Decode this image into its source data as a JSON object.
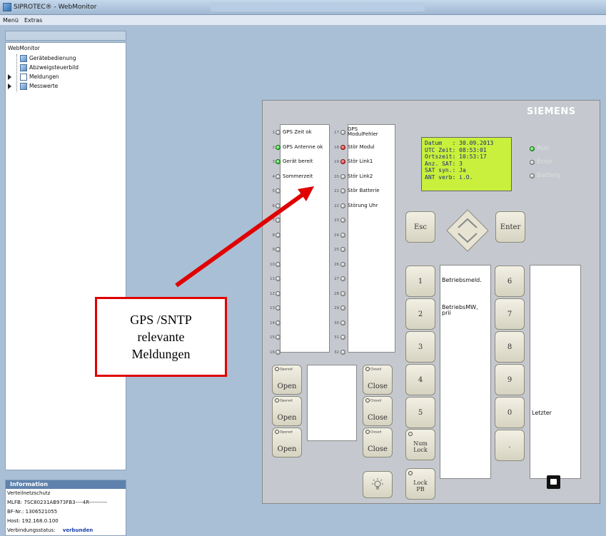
{
  "window": {
    "title": "SIPROTEC® - WebMonitor"
  },
  "menu": [
    "Menü",
    "Extras"
  ],
  "tree": {
    "root": "WebMonitor",
    "items": [
      {
        "label": "Gerätebedienung",
        "icon": "device-operation-icon"
      },
      {
        "label": "Abzweigsteuerbild",
        "icon": "feeder-control-icon"
      },
      {
        "label": "Meldungen",
        "icon": "messages-icon"
      },
      {
        "label": "Messwerte",
        "icon": "measurements-icon"
      }
    ]
  },
  "info": {
    "header": "Information",
    "lines": [
      "Verteilnetzschutz",
      "MLFB:  7SC80231AB973FB3----4R----------",
      "BF-Nr.: 1306521055",
      "Host: 192.168.0.100"
    ],
    "status_label": "Verbindungsstatus:",
    "status_value": "verbunden"
  },
  "device": {
    "brand": "SIEMENS",
    "leds_left": [
      {
        "n": "1",
        "label": "GPS Zeit ok",
        "color": "gray"
      },
      {
        "n": "2",
        "label": "GPS Antenne ok",
        "color": "green"
      },
      {
        "n": "3",
        "label": "Gerät bereit",
        "color": "green"
      },
      {
        "n": "4",
        "label": "Sommerzeit",
        "color": "gray"
      },
      {
        "n": "5",
        "label": "",
        "color": "gray"
      },
      {
        "n": "6",
        "label": "",
        "color": "gray"
      },
      {
        "n": "7",
        "label": "",
        "color": "gray"
      },
      {
        "n": "8",
        "label": "",
        "color": "gray"
      },
      {
        "n": "9",
        "label": "",
        "color": "gray"
      },
      {
        "n": "10",
        "label": "",
        "color": "gray"
      },
      {
        "n": "11",
        "label": "",
        "color": "gray"
      },
      {
        "n": "12",
        "label": "",
        "color": "gray"
      },
      {
        "n": "13",
        "label": "",
        "color": "gray"
      },
      {
        "n": "14",
        "label": "",
        "color": "gray"
      },
      {
        "n": "15",
        "label": "",
        "color": "gray"
      },
      {
        "n": "16",
        "label": "",
        "color": "gray"
      }
    ],
    "leds_right": [
      {
        "n": "17",
        "label": "GPS\nModulFehler",
        "color": "gray"
      },
      {
        "n": "18",
        "label": "Stör Modul",
        "color": "red"
      },
      {
        "n": "19",
        "label": "Stör Link1",
        "color": "red"
      },
      {
        "n": "20",
        "label": "Stör Link2",
        "color": "gray"
      },
      {
        "n": "21",
        "label": "Stör Batterie",
        "color": "gray"
      },
      {
        "n": "22",
        "label": "Störung Uhr",
        "color": "gray"
      },
      {
        "n": "23",
        "label": "",
        "color": "gray"
      },
      {
        "n": "24",
        "label": "",
        "color": "gray"
      },
      {
        "n": "25",
        "label": "",
        "color": "gray"
      },
      {
        "n": "26",
        "label": "",
        "color": "gray"
      },
      {
        "n": "27",
        "label": "",
        "color": "gray"
      },
      {
        "n": "28",
        "label": "",
        "color": "gray"
      },
      {
        "n": "29",
        "label": "",
        "color": "gray"
      },
      {
        "n": "30",
        "label": "",
        "color": "gray"
      },
      {
        "n": "31",
        "label": "",
        "color": "gray"
      },
      {
        "n": "32",
        "label": "",
        "color": "gray"
      }
    ],
    "lcd": [
      "Datum   : 30.09.2013",
      "UTC Zeit: 08:53:01",
      "Ortszeit: 10:53:17",
      "Anz. SAT: 3",
      "SAT syn.: Ja",
      "ANT verb: i.O."
    ],
    "status_leds": [
      {
        "label": "Run",
        "color": "green"
      },
      {
        "label": "Error",
        "color": "gray"
      },
      {
        "label": "Battery",
        "color": "gray"
      }
    ],
    "keys": {
      "esc": "Esc",
      "enter": "Enter",
      "num": [
        "1",
        "2",
        "3",
        "4",
        "5"
      ],
      "num2": [
        "6",
        "7",
        "8",
        "9",
        "0",
        "."
      ],
      "numlock": "Num\nLock",
      "lockpb": "Lock\nPB",
      "opened": "Opened",
      "closed": "Closed",
      "open": "Open",
      "close": "Close"
    },
    "function_labels": [
      "Betriebsmeld.",
      "BetriebsMW,\nprii"
    ],
    "right_box_label": "Letzter",
    "usb": "USB"
  },
  "callout": {
    "lines": [
      "GPS /SNTP",
      "relevante",
      "Meldungen"
    ]
  },
  "colors": {
    "arrow": "#e00000",
    "lcd": "#c8f03c",
    "led_green": "#17b717",
    "led_red": "#d61414"
  }
}
